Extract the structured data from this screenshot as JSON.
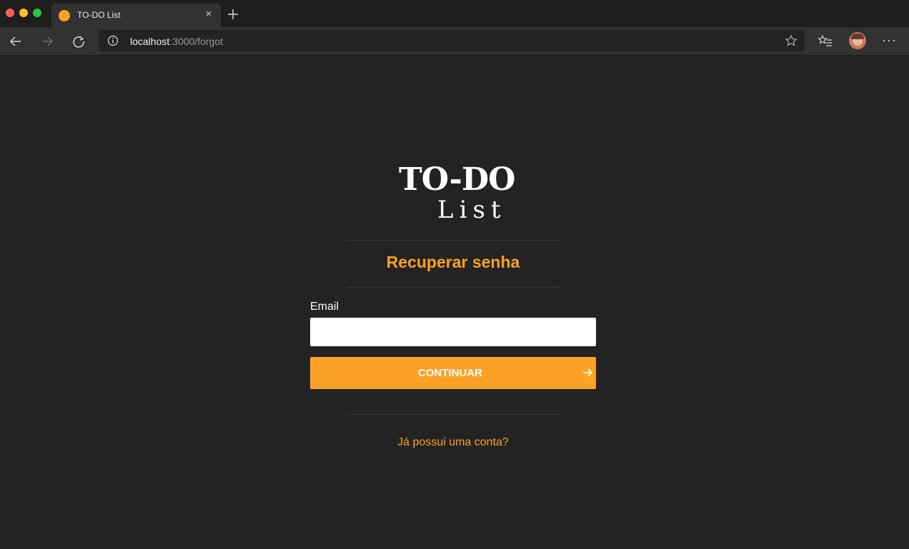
{
  "browser": {
    "tab_title": "TO-DO List",
    "tab_close": "×",
    "url_host": "localhost",
    "url_path": ":3000/forgot",
    "menu": "···"
  },
  "logo": {
    "line1": "TO-DO",
    "line2": "List"
  },
  "form": {
    "title": "Recuperar senha",
    "email_label": "Email",
    "email_value": "",
    "email_placeholder": "",
    "submit_label": "CONTINUAR"
  },
  "footer": {
    "login_link": "Já possui uma conta?"
  },
  "colors": {
    "accent": "#fca125",
    "background": "#232323",
    "chrome": "#323232"
  }
}
